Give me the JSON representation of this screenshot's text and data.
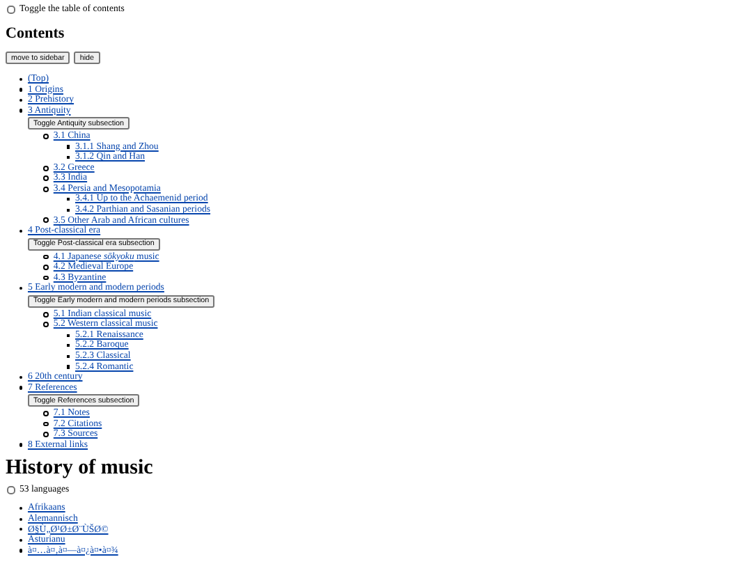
{
  "toc_toggle": {
    "label": "Toggle the table of contents",
    "checked": false
  },
  "contents_heading": "Contents",
  "toc_buttons": [
    "move to sidebar",
    "hide"
  ],
  "toc": [
    {
      "label": "(Top)"
    },
    {
      "label": "1 Origins"
    },
    {
      "label": "2 Prehistory"
    },
    {
      "label": "3 Antiquity",
      "toggle": "Toggle Antiquity subsection",
      "children": [
        {
          "label": "3.1 China",
          "children": [
            {
              "label": "3.1.1 Shang and Zhou"
            },
            {
              "label": "3.1.2 Qin and Han"
            }
          ]
        },
        {
          "label": "3.2 Greece"
        },
        {
          "label": "3.3 India"
        },
        {
          "label": "3.4 Persia and Mesopotamia",
          "children": [
            {
              "label": "3.4.1 Up to the Achaemenid period"
            },
            {
              "label": "3.4.2 Parthian and Sasanian periods"
            }
          ]
        },
        {
          "label": "3.5 Other Arab and African cultures"
        }
      ]
    },
    {
      "label": "4 Post-classical era",
      "toggle": "Toggle Post-classical era subsection",
      "children": [
        {
          "label": "4.1 Japanese *sōkyoku* music"
        },
        {
          "label": "4.2 Medieval Europe"
        },
        {
          "label": "4.3 Byzantine"
        }
      ]
    },
    {
      "label": "5 Early modern and modern periods",
      "toggle": "Toggle Early modern and modern periods subsection",
      "children": [
        {
          "label": "5.1 Indian classical music"
        },
        {
          "label": "5.2 Western classical music",
          "children": [
            {
              "label": "5.2.1 Renaissance"
            },
            {
              "label": "5.2.2 Baroque"
            },
            {
              "label": "5.2.3 Classical"
            },
            {
              "label": "5.2.4 Romantic"
            }
          ]
        }
      ]
    },
    {
      "label": "6 20th century"
    },
    {
      "label": "7 References",
      "toggle": "Toggle References subsection",
      "children": [
        {
          "label": "7.1 Notes"
        },
        {
          "label": "7.2 Citations"
        },
        {
          "label": "7.3 Sources"
        }
      ]
    },
    {
      "label": "8 External links"
    }
  ],
  "page_title": "History of music",
  "languages_toggle": {
    "label": "53 languages",
    "checked": false
  },
  "languages": [
    "Afrikaans",
    "Alemannisch",
    "Ø§Ù„Ø¹Ø±Ø¨ÙŠØ©",
    "Asturianu",
    "à¤…à¤‚à¤—à¤¿à¤•à¤¾"
  ]
}
